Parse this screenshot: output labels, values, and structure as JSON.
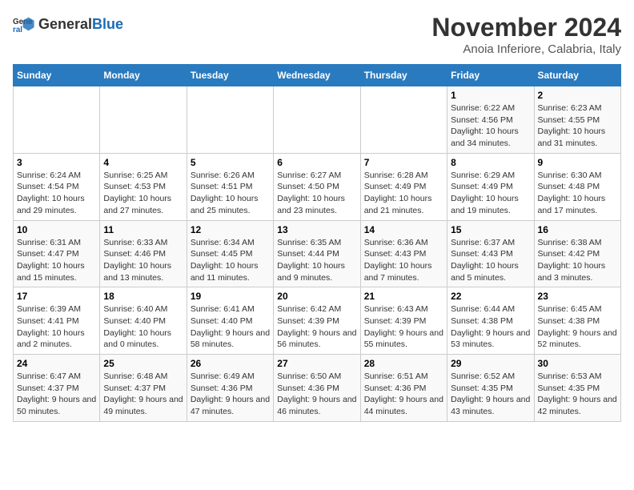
{
  "logo": {
    "text_general": "General",
    "text_blue": "Blue"
  },
  "title": "November 2024",
  "subtitle": "Anoia Inferiore, Calabria, Italy",
  "headers": [
    "Sunday",
    "Monday",
    "Tuesday",
    "Wednesday",
    "Thursday",
    "Friday",
    "Saturday"
  ],
  "rows": [
    [
      {
        "day": "",
        "detail": ""
      },
      {
        "day": "",
        "detail": ""
      },
      {
        "day": "",
        "detail": ""
      },
      {
        "day": "",
        "detail": ""
      },
      {
        "day": "",
        "detail": ""
      },
      {
        "day": "1",
        "detail": "Sunrise: 6:22 AM\nSunset: 4:56 PM\nDaylight: 10 hours and 34 minutes."
      },
      {
        "day": "2",
        "detail": "Sunrise: 6:23 AM\nSunset: 4:55 PM\nDaylight: 10 hours and 31 minutes."
      }
    ],
    [
      {
        "day": "3",
        "detail": "Sunrise: 6:24 AM\nSunset: 4:54 PM\nDaylight: 10 hours and 29 minutes."
      },
      {
        "day": "4",
        "detail": "Sunrise: 6:25 AM\nSunset: 4:53 PM\nDaylight: 10 hours and 27 minutes."
      },
      {
        "day": "5",
        "detail": "Sunrise: 6:26 AM\nSunset: 4:51 PM\nDaylight: 10 hours and 25 minutes."
      },
      {
        "day": "6",
        "detail": "Sunrise: 6:27 AM\nSunset: 4:50 PM\nDaylight: 10 hours and 23 minutes."
      },
      {
        "day": "7",
        "detail": "Sunrise: 6:28 AM\nSunset: 4:49 PM\nDaylight: 10 hours and 21 minutes."
      },
      {
        "day": "8",
        "detail": "Sunrise: 6:29 AM\nSunset: 4:49 PM\nDaylight: 10 hours and 19 minutes."
      },
      {
        "day": "9",
        "detail": "Sunrise: 6:30 AM\nSunset: 4:48 PM\nDaylight: 10 hours and 17 minutes."
      }
    ],
    [
      {
        "day": "10",
        "detail": "Sunrise: 6:31 AM\nSunset: 4:47 PM\nDaylight: 10 hours and 15 minutes."
      },
      {
        "day": "11",
        "detail": "Sunrise: 6:33 AM\nSunset: 4:46 PM\nDaylight: 10 hours and 13 minutes."
      },
      {
        "day": "12",
        "detail": "Sunrise: 6:34 AM\nSunset: 4:45 PM\nDaylight: 10 hours and 11 minutes."
      },
      {
        "day": "13",
        "detail": "Sunrise: 6:35 AM\nSunset: 4:44 PM\nDaylight: 10 hours and 9 minutes."
      },
      {
        "day": "14",
        "detail": "Sunrise: 6:36 AM\nSunset: 4:43 PM\nDaylight: 10 hours and 7 minutes."
      },
      {
        "day": "15",
        "detail": "Sunrise: 6:37 AM\nSunset: 4:43 PM\nDaylight: 10 hours and 5 minutes."
      },
      {
        "day": "16",
        "detail": "Sunrise: 6:38 AM\nSunset: 4:42 PM\nDaylight: 10 hours and 3 minutes."
      }
    ],
    [
      {
        "day": "17",
        "detail": "Sunrise: 6:39 AM\nSunset: 4:41 PM\nDaylight: 10 hours and 2 minutes."
      },
      {
        "day": "18",
        "detail": "Sunrise: 6:40 AM\nSunset: 4:40 PM\nDaylight: 10 hours and 0 minutes."
      },
      {
        "day": "19",
        "detail": "Sunrise: 6:41 AM\nSunset: 4:40 PM\nDaylight: 9 hours and 58 minutes."
      },
      {
        "day": "20",
        "detail": "Sunrise: 6:42 AM\nSunset: 4:39 PM\nDaylight: 9 hours and 56 minutes."
      },
      {
        "day": "21",
        "detail": "Sunrise: 6:43 AM\nSunset: 4:39 PM\nDaylight: 9 hours and 55 minutes."
      },
      {
        "day": "22",
        "detail": "Sunrise: 6:44 AM\nSunset: 4:38 PM\nDaylight: 9 hours and 53 minutes."
      },
      {
        "day": "23",
        "detail": "Sunrise: 6:45 AM\nSunset: 4:38 PM\nDaylight: 9 hours and 52 minutes."
      }
    ],
    [
      {
        "day": "24",
        "detail": "Sunrise: 6:47 AM\nSunset: 4:37 PM\nDaylight: 9 hours and 50 minutes."
      },
      {
        "day": "25",
        "detail": "Sunrise: 6:48 AM\nSunset: 4:37 PM\nDaylight: 9 hours and 49 minutes."
      },
      {
        "day": "26",
        "detail": "Sunrise: 6:49 AM\nSunset: 4:36 PM\nDaylight: 9 hours and 47 minutes."
      },
      {
        "day": "27",
        "detail": "Sunrise: 6:50 AM\nSunset: 4:36 PM\nDaylight: 9 hours and 46 minutes."
      },
      {
        "day": "28",
        "detail": "Sunrise: 6:51 AM\nSunset: 4:36 PM\nDaylight: 9 hours and 44 minutes."
      },
      {
        "day": "29",
        "detail": "Sunrise: 6:52 AM\nSunset: 4:35 PM\nDaylight: 9 hours and 43 minutes."
      },
      {
        "day": "30",
        "detail": "Sunrise: 6:53 AM\nSunset: 4:35 PM\nDaylight: 9 hours and 42 minutes."
      }
    ]
  ]
}
